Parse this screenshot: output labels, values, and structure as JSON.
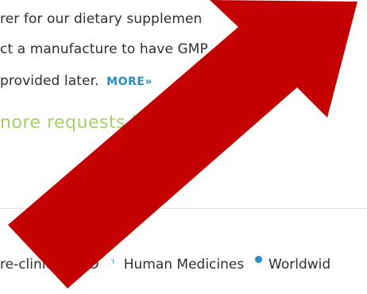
{
  "request": {
    "line1": "rer for our dietary supplemen",
    "line2": "ct a manufacture to have GMP",
    "line3": " provided later.",
    "more_link": "MORE»"
  },
  "more_requests": "nore requests li",
  "tags": {
    "tag1": "re-clinical CRO",
    "tag2": "Human Medicines",
    "tag3": "Worldwid"
  },
  "colors": {
    "accent_blue": "#2a8fc0",
    "link_green": "#a9cf6b",
    "arrow_red": "#c40000"
  },
  "icons": {
    "tag2_icon": "bracket-icon",
    "tag3_icon": "dot-icon"
  }
}
